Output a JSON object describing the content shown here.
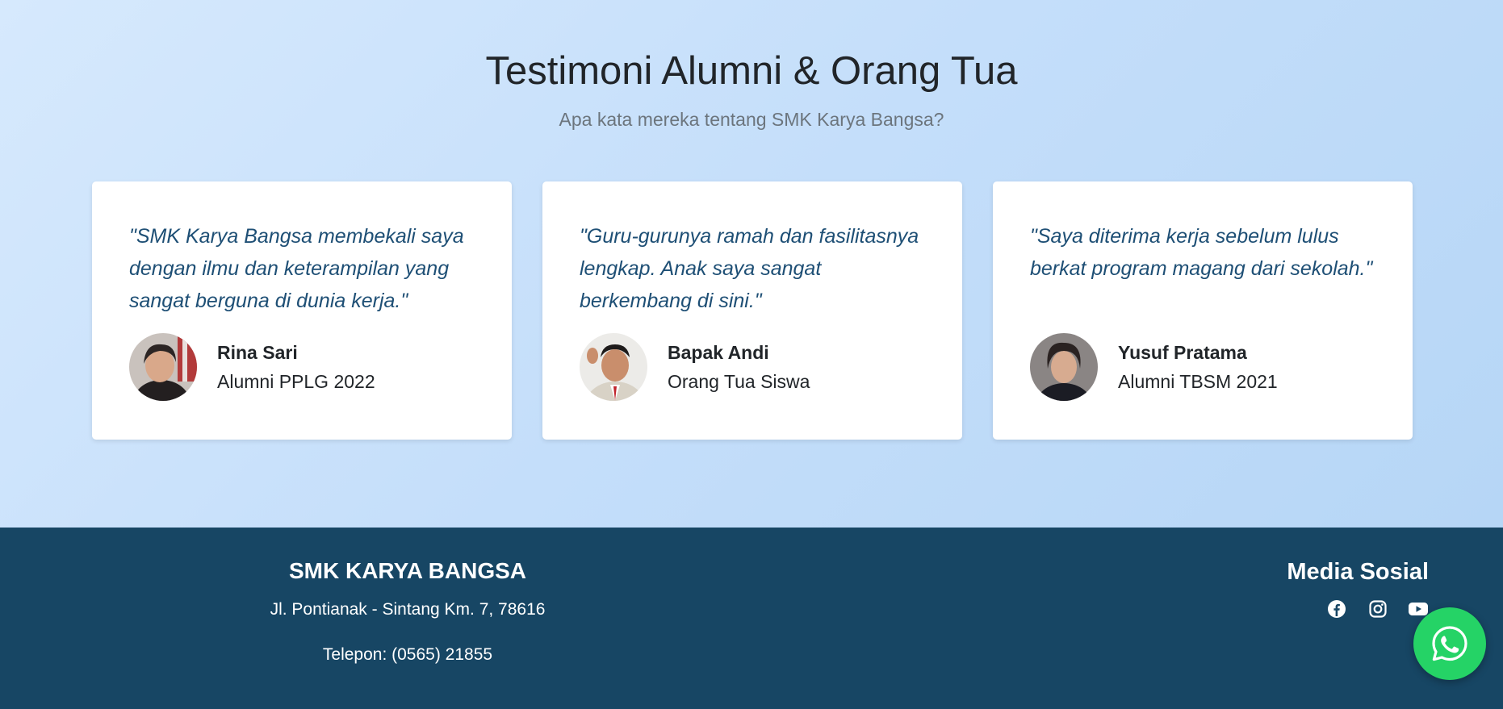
{
  "testimonials": {
    "title": "Testimoni Alumni & Orang Tua",
    "subtitle": "Apa kata mereka tentang SMK Karya Bangsa?",
    "items": [
      {
        "quote": "\"SMK Karya Bangsa membekali saya dengan ilmu dan keterampilan yang sangat berguna di dunia kerja.\"",
        "name": "Rina Sari",
        "role": "Alumni PPLG 2022",
        "avatar": "avatar-photo"
      },
      {
        "quote": "\"Guru-gurunya ramah dan fasilitasnya lengkap. Anak saya sangat berkembang di sini.\"",
        "name": "Bapak Andi",
        "role": "Orang Tua Siswa",
        "avatar": "avatar-photo"
      },
      {
        "quote": "\"Saya diterima kerja sebelum lulus berkat program magang dari sekolah.\"",
        "name": "Yusuf Pratama",
        "role": "Alumni TBSM 2021",
        "avatar": "avatar-photo"
      }
    ]
  },
  "footer": {
    "school_name": "SMK KARYA BANGSA",
    "address": "Jl. Pontianak - Sintang Km. 7, 78616",
    "phone": "Telepon: (0565) 21855",
    "social_title": "Media Sosial",
    "social_icons": [
      "facebook-icon",
      "instagram-icon",
      "youtube-icon"
    ]
  },
  "whatsapp_button": {
    "icon": "whatsapp-icon"
  },
  "colors": {
    "section_bg": "#c4defa",
    "quote_text": "#1e4f75",
    "footer_bg": "#174664",
    "whatsapp_green": "#25d366"
  }
}
